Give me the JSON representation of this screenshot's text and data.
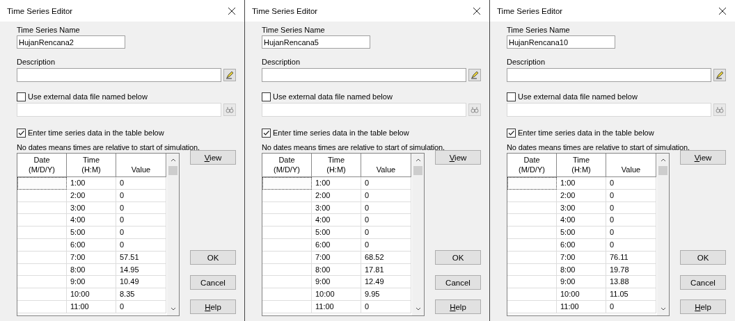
{
  "dialogs": [
    {
      "window": {
        "title": "Time Series Editor"
      },
      "name_label": "Time Series Name",
      "name_value": "HujanRencana2",
      "description_label": "Description",
      "external_file": {
        "label": "Use external data file named below",
        "checked": false
      },
      "table_entry": {
        "label": "Enter time series data in the table below",
        "checked": true
      },
      "note": "No dates means times are relative to start of simulation.",
      "table": {
        "columns": [
          "Date\n(M/D/Y)",
          "Time\n(H:M)",
          "Value"
        ],
        "rows": [
          {
            "date_focused": true,
            "time": "1:00",
            "value": "0"
          },
          {
            "date_focused": false,
            "time": "2:00",
            "value": "0"
          },
          {
            "date_focused": false,
            "time": "3:00",
            "value": "0"
          },
          {
            "date_focused": false,
            "time": "4:00",
            "value": "0"
          },
          {
            "date_focused": false,
            "time": "5:00",
            "value": "0"
          },
          {
            "date_focused": false,
            "time": "6:00",
            "value": "0"
          },
          {
            "date_focused": false,
            "time": "7:00",
            "value": "57.51"
          },
          {
            "date_focused": false,
            "time": "8:00",
            "value": "14.95"
          },
          {
            "date_focused": false,
            "time": "9:00",
            "value": "10.49"
          },
          {
            "date_focused": false,
            "time": "10:00",
            "value": "8.35"
          },
          {
            "date_focused": false,
            "time": "11:00",
            "value": "0"
          }
        ]
      },
      "buttons": [
        {
          "kind": "view",
          "label": "View",
          "underlined_initial": true
        },
        {
          "kind": "ok",
          "label": "OK",
          "underlined_initial": false
        },
        {
          "kind": "cancel",
          "label": "Cancel",
          "underlined_initial": false
        },
        {
          "kind": "help",
          "label": "Help",
          "underlined_initial": true
        }
      ]
    },
    {
      "window": {
        "title": "Time Series Editor"
      },
      "name_label": "Time Series Name",
      "name_value": "HujanRencana5",
      "description_label": "Description",
      "external_file": {
        "label": "Use external data file named below",
        "checked": false
      },
      "table_entry": {
        "label": "Enter time series data in the table below",
        "checked": true
      },
      "note": "No dates means times are relative to start of simulation.",
      "table": {
        "columns": [
          "Date\n(M/D/Y)",
          "Time\n(H:M)",
          "Value"
        ],
        "rows": [
          {
            "date_focused": true,
            "time": "1:00",
            "value": "0"
          },
          {
            "date_focused": false,
            "time": "2:00",
            "value": "0"
          },
          {
            "date_focused": false,
            "time": "3:00",
            "value": "0"
          },
          {
            "date_focused": false,
            "time": "4:00",
            "value": "0"
          },
          {
            "date_focused": false,
            "time": "5:00",
            "value": "0"
          },
          {
            "date_focused": false,
            "time": "6:00",
            "value": "0"
          },
          {
            "date_focused": false,
            "time": "7:00",
            "value": "68.52"
          },
          {
            "date_focused": false,
            "time": "8:00",
            "value": "17.81"
          },
          {
            "date_focused": false,
            "time": "9:00",
            "value": "12.49"
          },
          {
            "date_focused": false,
            "time": "10:00",
            "value": "9.95"
          },
          {
            "date_focused": false,
            "time": "11:00",
            "value": "0"
          }
        ]
      },
      "buttons": [
        {
          "kind": "view",
          "label": "View",
          "underlined_initial": true
        },
        {
          "kind": "ok",
          "label": "OK",
          "underlined_initial": false
        },
        {
          "kind": "cancel",
          "label": "Cancel",
          "underlined_initial": false
        },
        {
          "kind": "help",
          "label": "Help",
          "underlined_initial": true
        }
      ]
    },
    {
      "window": {
        "title": "Time Series Editor"
      },
      "name_label": "Time Series Name",
      "name_value": "HujanRencana10",
      "description_label": "Description",
      "external_file": {
        "label": "Use external data file named below",
        "checked": false
      },
      "table_entry": {
        "label": "Enter time series data in the table below",
        "checked": true
      },
      "note": "No dates means times are relative to start of simulation.",
      "table": {
        "columns": [
          "Date\n(M/D/Y)",
          "Time\n(H:M)",
          "Value"
        ],
        "rows": [
          {
            "date_focused": true,
            "time": "1:00",
            "value": "0"
          },
          {
            "date_focused": false,
            "time": "2:00",
            "value": "0"
          },
          {
            "date_focused": false,
            "time": "3:00",
            "value": "0"
          },
          {
            "date_focused": false,
            "time": "4:00",
            "value": "0"
          },
          {
            "date_focused": false,
            "time": "5:00",
            "value": "0"
          },
          {
            "date_focused": false,
            "time": "6:00",
            "value": "0"
          },
          {
            "date_focused": false,
            "time": "7:00",
            "value": "76.11"
          },
          {
            "date_focused": false,
            "time": "8:00",
            "value": "19.78"
          },
          {
            "date_focused": false,
            "time": "9:00",
            "value": "13.88"
          },
          {
            "date_focused": false,
            "time": "10:00",
            "value": "11.05"
          },
          {
            "date_focused": false,
            "time": "11:00",
            "value": "0"
          }
        ]
      },
      "buttons": [
        {
          "kind": "view",
          "label": "View",
          "underlined_initial": true
        },
        {
          "kind": "ok",
          "label": "OK",
          "underlined_initial": false
        },
        {
          "kind": "cancel",
          "label": "Cancel",
          "underlined_initial": false
        },
        {
          "kind": "help",
          "label": "Help",
          "underlined_initial": true
        }
      ]
    }
  ]
}
